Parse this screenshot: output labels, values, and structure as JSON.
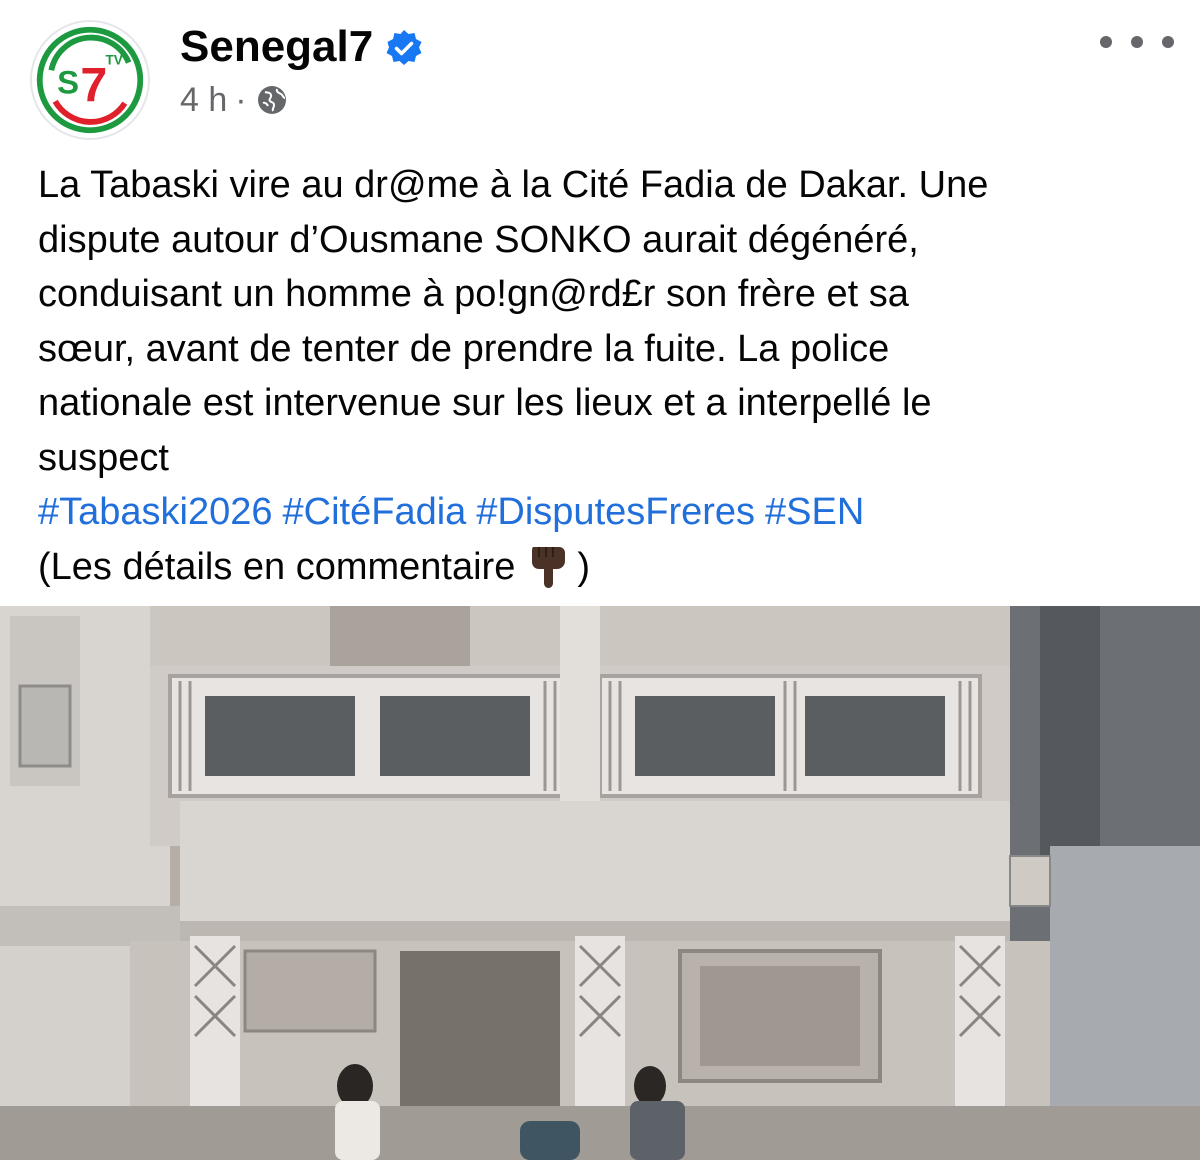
{
  "post": {
    "author": {
      "name": "Senegal7",
      "avatar_logo_text": "S7",
      "avatar_logo_badge": "TV",
      "verified": true
    },
    "meta": {
      "time": "4 h",
      "separator": "·",
      "audience_icon": "globe-icon"
    },
    "menu_icon": "more-horizontal-icon",
    "text_lines": [
      "La Tabaski vire au dr@me à la Cité Fadia de Dakar. Une",
      "dispute autour d’Ousmane SONKO aurait dégénéré,",
      "conduisant un homme à po!gn@rd£r son frère et sa",
      "sœur, avant de tenter de prendre la fuite. La police",
      "nationale est intervenue sur les lieux et a interpellé le",
      "suspect"
    ],
    "hashtags": [
      "#Tabaski2026",
      "#CitéFadia",
      "#DisputesFreres",
      "#SEN"
    ],
    "footer_text_start": "(Les détails en commentaire",
    "footer_emoji": "pointing-down-icon",
    "footer_text_end": ")",
    "media_icon": "video-frame-building"
  },
  "colors": {
    "text": "#050505",
    "secondary": "#65676b",
    "link": "#216fdb",
    "verified": "#1877f2",
    "logo_green": "#1d9a3f",
    "logo_red": "#e0202a"
  }
}
